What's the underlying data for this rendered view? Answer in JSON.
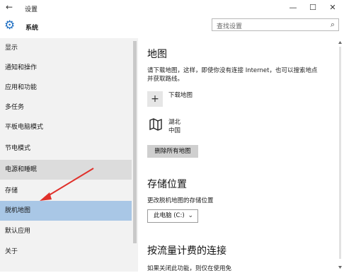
{
  "window": {
    "back_glyph": "←",
    "title": "设置",
    "minimize_glyph": "—",
    "maximize_glyph": "☐",
    "close_glyph": "✕"
  },
  "header": {
    "title": "系统",
    "search_placeholder": "查找设置",
    "search_icon": "⌕"
  },
  "sidebar": {
    "items": [
      {
        "label": "显示"
      },
      {
        "label": "通知和操作"
      },
      {
        "label": "应用和功能"
      },
      {
        "label": "多任务"
      },
      {
        "label": "平板电脑模式"
      },
      {
        "label": "节电模式"
      },
      {
        "label": "电源和睡眠"
      },
      {
        "label": "存储"
      },
      {
        "label": "脱机地图"
      },
      {
        "label": "默认应用"
      },
      {
        "label": "关于"
      }
    ],
    "selected_index": 8,
    "hover_index": 6
  },
  "main": {
    "maps_heading": "地图",
    "maps_desc_line1": "请下载地图，这样，即使你没有连接 Internet，也可以搜索地点",
    "maps_desc_line2": "并获取路线。",
    "download_label": "下载地图",
    "map_region": "湖北",
    "map_country": "中国",
    "delete_all_label": "删除所有地图",
    "storage_heading": "存储位置",
    "storage_desc": "更改脱机地图的存储位置",
    "storage_value": "此电脑 (C:)",
    "metered_heading": "按流量计费的连接",
    "metered_desc": "如果关闭此功能，则仅在使用免"
  },
  "colors": {
    "accent": "#1f6fc2",
    "selected_bg": "#a9c7e6",
    "annotation_arrow": "#e0302a"
  }
}
